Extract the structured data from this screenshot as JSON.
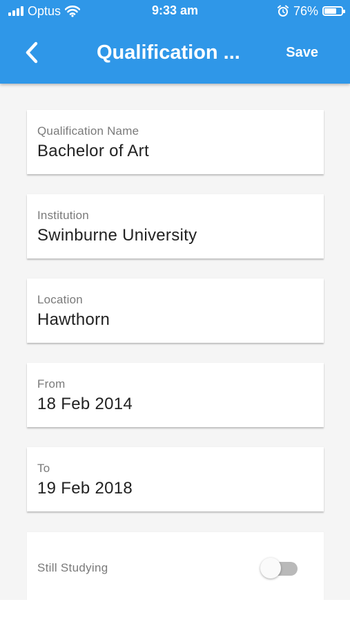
{
  "status_bar": {
    "carrier": "Optus",
    "time": "9:33 am",
    "battery": "76%",
    "battery_level": 0.76,
    "icons": [
      "signal-icon",
      "wifi-icon",
      "alarm-icon",
      "battery-icon"
    ]
  },
  "app_bar": {
    "title": "Qualification ...",
    "save_label": "Save",
    "back_icon": "chevron-left-icon"
  },
  "form": {
    "qualification_name": {
      "label": "Qualification Name",
      "value": "Bachelor of Art"
    },
    "institution": {
      "label": "Institution",
      "value": "Swinburne University"
    },
    "location": {
      "label": "Location",
      "value": "Hawthorn"
    },
    "from": {
      "label": "From",
      "value": "18 Feb 2014"
    },
    "to": {
      "label": "To",
      "value": "19 Feb 2018"
    },
    "still_studying": {
      "label": "Still Studying",
      "on": false
    }
  },
  "colors": {
    "primary": "#2f97e8",
    "background": "#f5f5f5",
    "card": "#ffffff",
    "label": "#7a7a7a",
    "value": "#222222",
    "toggle_off_track": "#b9b9b9"
  }
}
